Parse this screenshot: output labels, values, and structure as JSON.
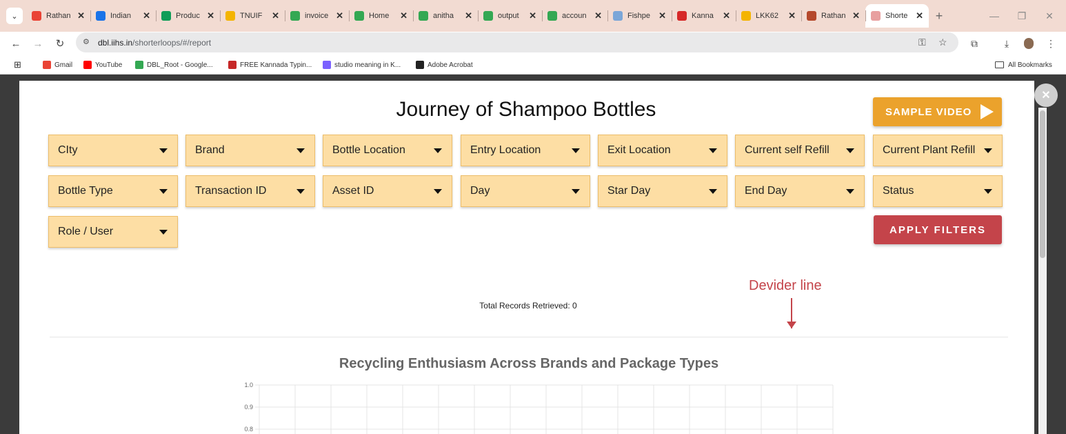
{
  "browser": {
    "tabs": [
      {
        "label": "Rathan",
        "color": "#ea4335",
        "glyph": "M"
      },
      {
        "label": "Indian",
        "color": "#1a73e8",
        "glyph": "11"
      },
      {
        "label": "Produc",
        "color": "#0f9d58",
        "glyph": "+"
      },
      {
        "label": "TNUIF",
        "color": "#f4b400",
        "glyph": ""
      },
      {
        "label": "invoice",
        "color": "#34a853",
        "glyph": "▲"
      },
      {
        "label": "Home",
        "color": "#34a853",
        "glyph": "▲"
      },
      {
        "label": "anitha",
        "color": "#34a853",
        "glyph": "▲"
      },
      {
        "label": "output",
        "color": "#34a853",
        "glyph": "▲"
      },
      {
        "label": "accoun",
        "color": "#34a853",
        "glyph": "▲"
      },
      {
        "label": "Fishpe",
        "color": "#7ba6d8",
        "glyph": "~"
      },
      {
        "label": "Kanna",
        "color": "#d62828",
        "glyph": "IT"
      },
      {
        "label": "LKK62",
        "color": "#f4b400",
        "glyph": ""
      },
      {
        "label": "Rathan",
        "color": "#b5482b",
        "glyph": "iihs"
      },
      {
        "label": "Shorte",
        "color": "#e8a0a0",
        "glyph": "▮"
      }
    ],
    "url_domain": "dbl.iihs.in",
    "url_path": "/shorterloops/#/report",
    "bookmarks": [
      {
        "label": "Gmail",
        "color": "#ea4335"
      },
      {
        "label": "YouTube",
        "color": "#ff0000"
      },
      {
        "label": "DBL_Root - Google...",
        "color": "#34a853"
      },
      {
        "label": "FREE Kannada Typin...",
        "color": "#c62828"
      },
      {
        "label": "studio meaning in K...",
        "color": "#7b61ff"
      },
      {
        "label": "Adobe Acrobat",
        "color": "#222222"
      }
    ],
    "all_bookmarks_label": "All Bookmarks"
  },
  "page": {
    "title": "Journey of Shampoo Bottles",
    "sample_video_label": "SAMPLE VIDEO",
    "filters_row1": [
      "CIty",
      "Brand",
      "Bottle Location",
      "Entry Location",
      "Exit Location",
      "Current self Refill",
      "Current Plant Refill"
    ],
    "filters_row2": [
      "Bottle Type",
      "Transaction ID",
      "Asset ID",
      "Day",
      "Star Day",
      "End Day",
      "Status"
    ],
    "filters_row3": [
      "Role / User"
    ],
    "apply_filters_label": "APPLY FILTERS",
    "total_records": "Total Records Retrieved: 0",
    "annotation": "Devider line"
  },
  "chart_data": {
    "type": "bar",
    "title": "Recycling Enthusiasm Across Brands and Package Types",
    "categories": [],
    "series": [],
    "y_ticks": [
      "1.0",
      "0.9",
      "0.8"
    ],
    "ylim": [
      0,
      1.0
    ],
    "grid": true
  },
  "colors": {
    "filter_bg": "#fddea4",
    "sample_video_bg": "#eba22c",
    "apply_bg": "#c4444a",
    "annotation": "#c4444a"
  }
}
